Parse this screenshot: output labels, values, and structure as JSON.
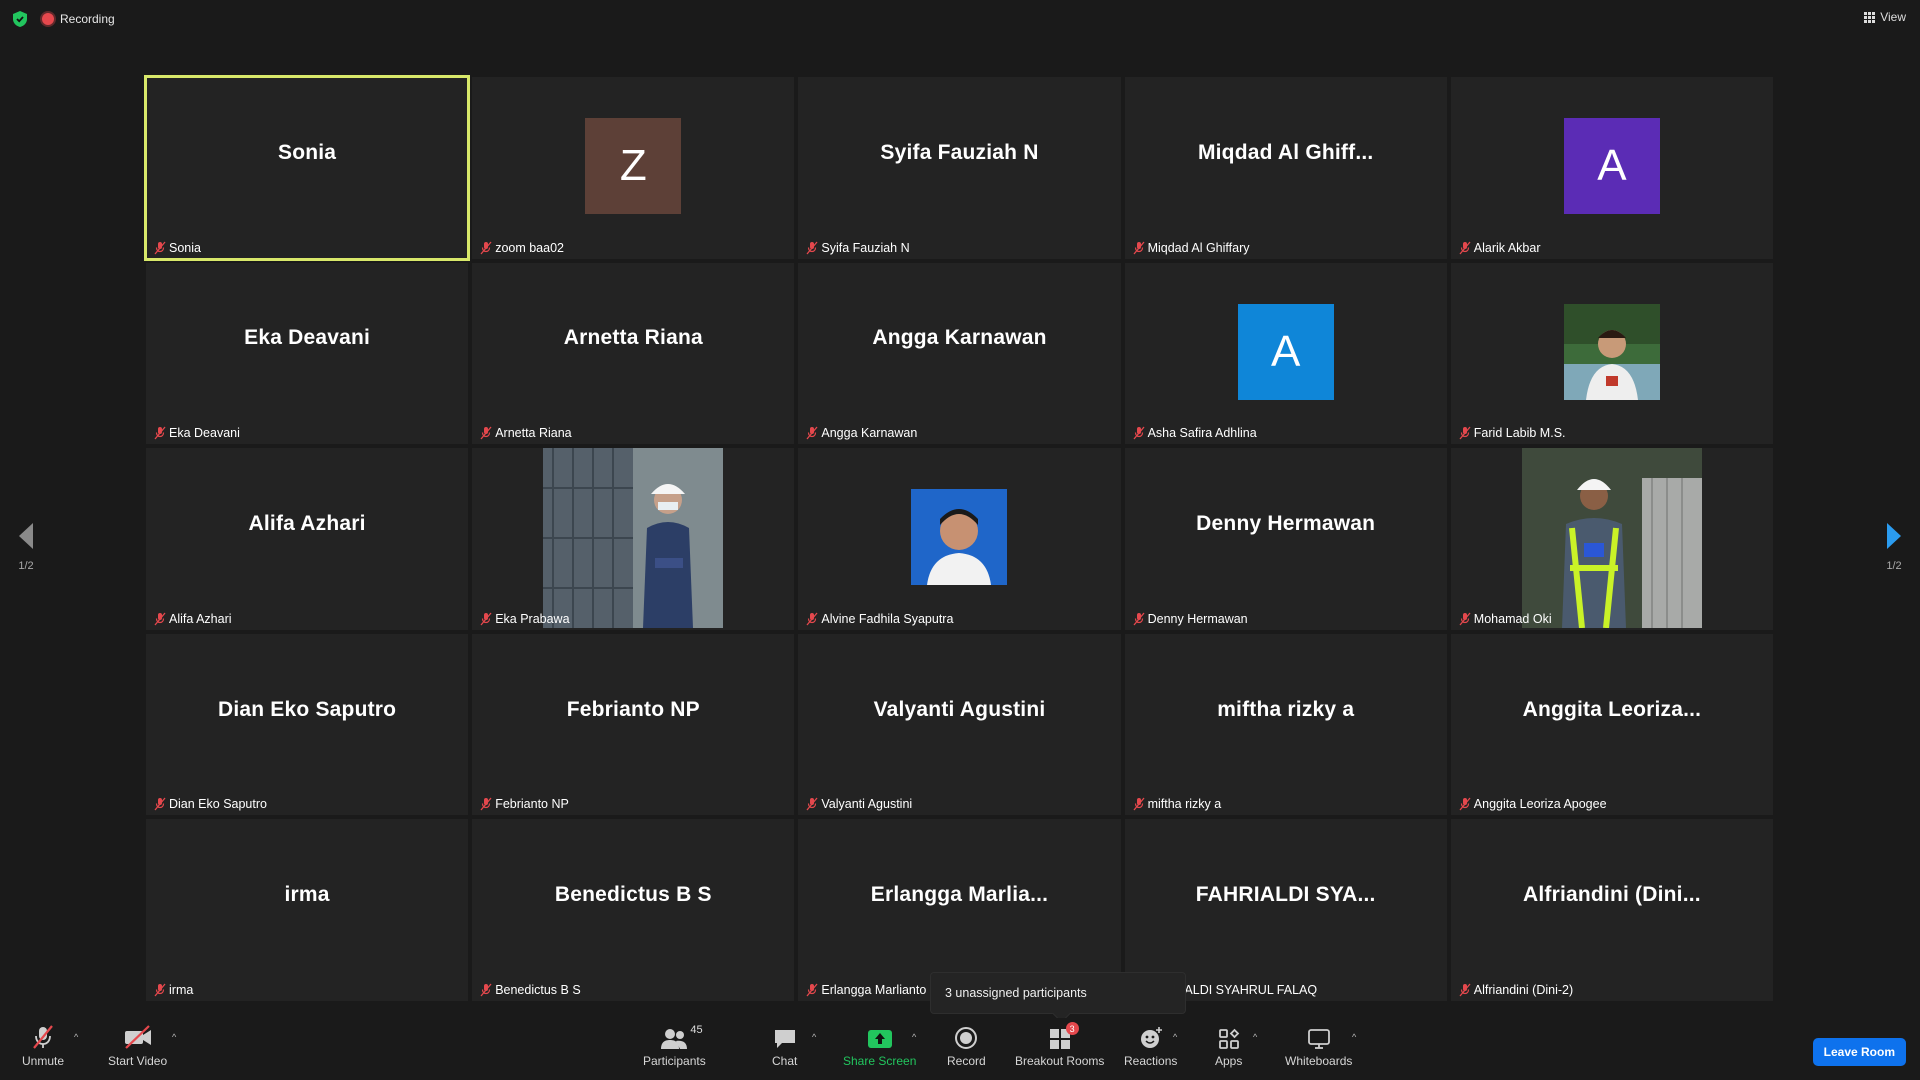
{
  "top": {
    "recording_label": "Recording",
    "view_label": "View"
  },
  "tiles": [
    {
      "big_name": "Sonia",
      "label": "Sonia",
      "active": true
    },
    {
      "big_name": "",
      "label": "zoom baa02",
      "avatar_letter": "Z",
      "avatar_color": "#5d4037"
    },
    {
      "big_name": "Syifa Fauziah N",
      "label": "Syifa Fauziah N"
    },
    {
      "big_name": "Miqdad  Al  Ghiff...",
      "label": "Miqdad Al Ghiffary"
    },
    {
      "big_name": "",
      "label": "Alarik Akbar",
      "avatar_letter": "A",
      "avatar_color": "#5b2cb5"
    },
    {
      "big_name": "Eka Deavani",
      "label": "Eka Deavani"
    },
    {
      "big_name": "Arnetta Riana",
      "label": "Arnetta Riana"
    },
    {
      "big_name": "Angga Karnawan",
      "label": "Angga Karnawan"
    },
    {
      "big_name": "",
      "label": "Asha Safira Adhlina",
      "avatar_letter": "A",
      "avatar_color": "#0f86d8"
    },
    {
      "big_name": "",
      "label": "Farid Labib M.S.",
      "photo": "small"
    },
    {
      "big_name": "Alifa Azhari",
      "label": "Alifa Azhari"
    },
    {
      "big_name": "",
      "label": "Eka Prabawa",
      "photo": "tall"
    },
    {
      "big_name": "",
      "label": "Alvine Fadhila Syaputra",
      "photo": "id"
    },
    {
      "big_name": "Denny Hermawan",
      "label": "Denny Hermawan"
    },
    {
      "big_name": "",
      "label": "Mohamad Oki",
      "photo": "tall2"
    },
    {
      "big_name": "Dian Eko Saputro",
      "label": "Dian Eko Saputro"
    },
    {
      "big_name": "Febrianto NP",
      "label": "Febrianto NP"
    },
    {
      "big_name": "Valyanti Agustini",
      "label": "Valyanti Agustini"
    },
    {
      "big_name": "miftha rizky a",
      "label": "miftha rizky a"
    },
    {
      "big_name": "Anggita  Leoriza...",
      "label": "Anggita Leoriza Apogee"
    },
    {
      "big_name": "irma",
      "label": "irma"
    },
    {
      "big_name": "Benedictus B S",
      "label": "Benedictus B S"
    },
    {
      "big_name": "Erlangga  Marlia...",
      "label": "Erlangga Marlianto"
    },
    {
      "big_name": "FAHRIALDI  SYA...",
      "label": "FAHRIALDI SYAHRUL FALAQ"
    },
    {
      "big_name": "Alfriandini  (Dini...",
      "label": "Alfriandini (Dini-2)"
    }
  ],
  "pager": {
    "left": "1/2",
    "right": "1/2"
  },
  "tooltip": "3 unassigned participants",
  "toolbar": {
    "unmute": "Unmute",
    "start_video": "Start Video",
    "participants": "Participants",
    "participants_count": "45",
    "chat": "Chat",
    "share_screen": "Share Screen",
    "record": "Record",
    "breakout_rooms": "Breakout Rooms",
    "breakout_badge": "3",
    "reactions": "Reactions",
    "apps": "Apps",
    "whiteboards": "Whiteboards",
    "leave_room": "Leave Room"
  }
}
